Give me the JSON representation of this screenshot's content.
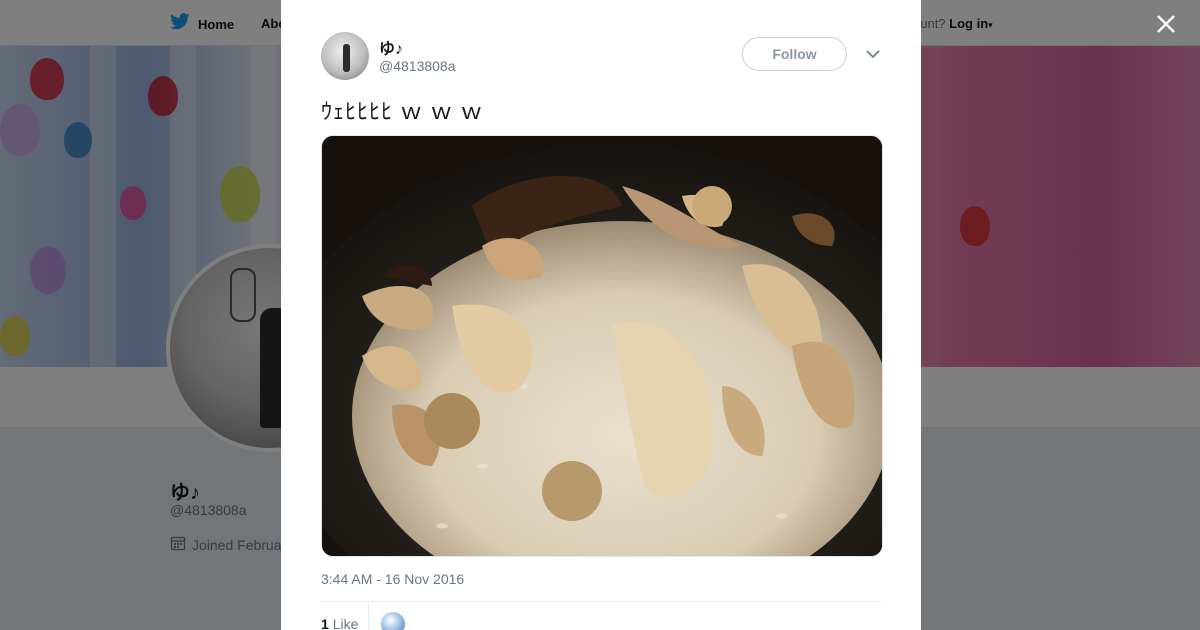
{
  "nav": {
    "home_label": "Home",
    "about_label": "Abo",
    "login_prefix": "ccount?",
    "login_label": "Log in"
  },
  "profile": {
    "name": "ゆ♪",
    "handle": "@4813808a",
    "joined": "Joined Februa"
  },
  "tweet": {
    "author_name": "ゆ♪",
    "author_handle": "@4813808a",
    "follow_label": "Follow",
    "text": "ｳｪﾋﾋﾋﾋ ｗ ｗ ｗ",
    "timestamp": "3:44 AM - 16 Nov 2016",
    "like_count": "1",
    "like_label": "Like"
  },
  "icons": {
    "home": "twitter-bird-icon",
    "close": "close-icon",
    "caret": "chevron-down-icon",
    "calendar": "calendar-icon"
  },
  "colors": {
    "twitter_blue": "#1da1f2",
    "text_primary": "#14171a",
    "text_secondary": "#657786"
  }
}
